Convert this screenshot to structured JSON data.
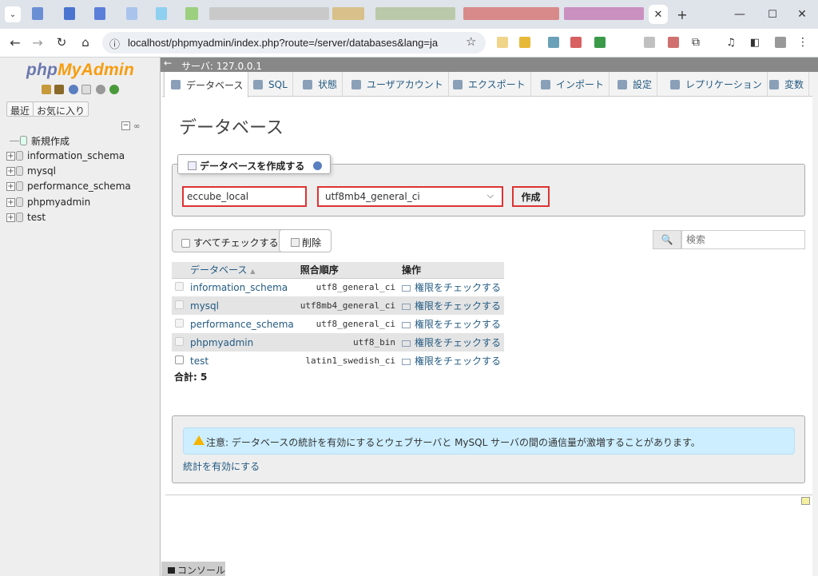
{
  "browser": {
    "url": "localhost/phpmyadmin/index.php?route=/server/databases&lang=ja"
  },
  "nav": {
    "logo_php": "php",
    "logo_my": "MyAdmin",
    "recent_label": "最近",
    "favorites_label": "お気に入り",
    "new_label": "新規作成",
    "databases": [
      "information_schema",
      "mysql",
      "performance_schema",
      "phpmyadmin",
      "test"
    ]
  },
  "serverbar": {
    "label": "サーバ: 127.0.0.1"
  },
  "tabs": [
    {
      "label": "データベース",
      "icon": "database-icon",
      "active": true
    },
    {
      "label": "SQL",
      "icon": "sql-icon"
    },
    {
      "label": "状態",
      "icon": "status-icon"
    },
    {
      "label": "ユーザアカウント",
      "icon": "users-icon"
    },
    {
      "label": "エクスポート",
      "icon": "export-icon"
    },
    {
      "label": "インポート",
      "icon": "import-icon"
    },
    {
      "label": "設定",
      "icon": "settings-icon"
    },
    {
      "label": "レプリケーション",
      "icon": "replication-icon"
    },
    {
      "label": "変数",
      "icon": "variables-icon"
    }
  ],
  "main": {
    "heading": "データベース",
    "create": {
      "legend": "データベースを作成する",
      "name_value": "eccube_local",
      "collation_value": "utf8mb4_general_ci",
      "button": "作成"
    },
    "check_all": "すべてチェックする",
    "drop": "削除",
    "search_button": "🔍",
    "search_placeholder": "検索",
    "table": {
      "headers": [
        "データベース",
        "照合順序",
        "操作"
      ],
      "rows": [
        {
          "name": "information_schema",
          "collation": "utf8_general_ci",
          "action": "権限をチェックする"
        },
        {
          "name": "mysql",
          "collation": "utf8mb4_general_ci",
          "action": "権限をチェックする"
        },
        {
          "name": "performance_schema",
          "collation": "utf8_general_ci",
          "action": "権限をチェックする"
        },
        {
          "name": "phpmyadmin",
          "collation": "utf8_bin",
          "action": "権限をチェックする"
        },
        {
          "name": "test",
          "collation": "latin1_swedish_ci",
          "action": "権限をチェックする"
        }
      ]
    },
    "total": "合計: 5",
    "notice": "注意: データベースの統計を有効にするとウェブサーバと MySQL サーバの間の通信量が激増することがあります。",
    "enable_stats": "統計を有効にする",
    "console": "コンソール"
  }
}
